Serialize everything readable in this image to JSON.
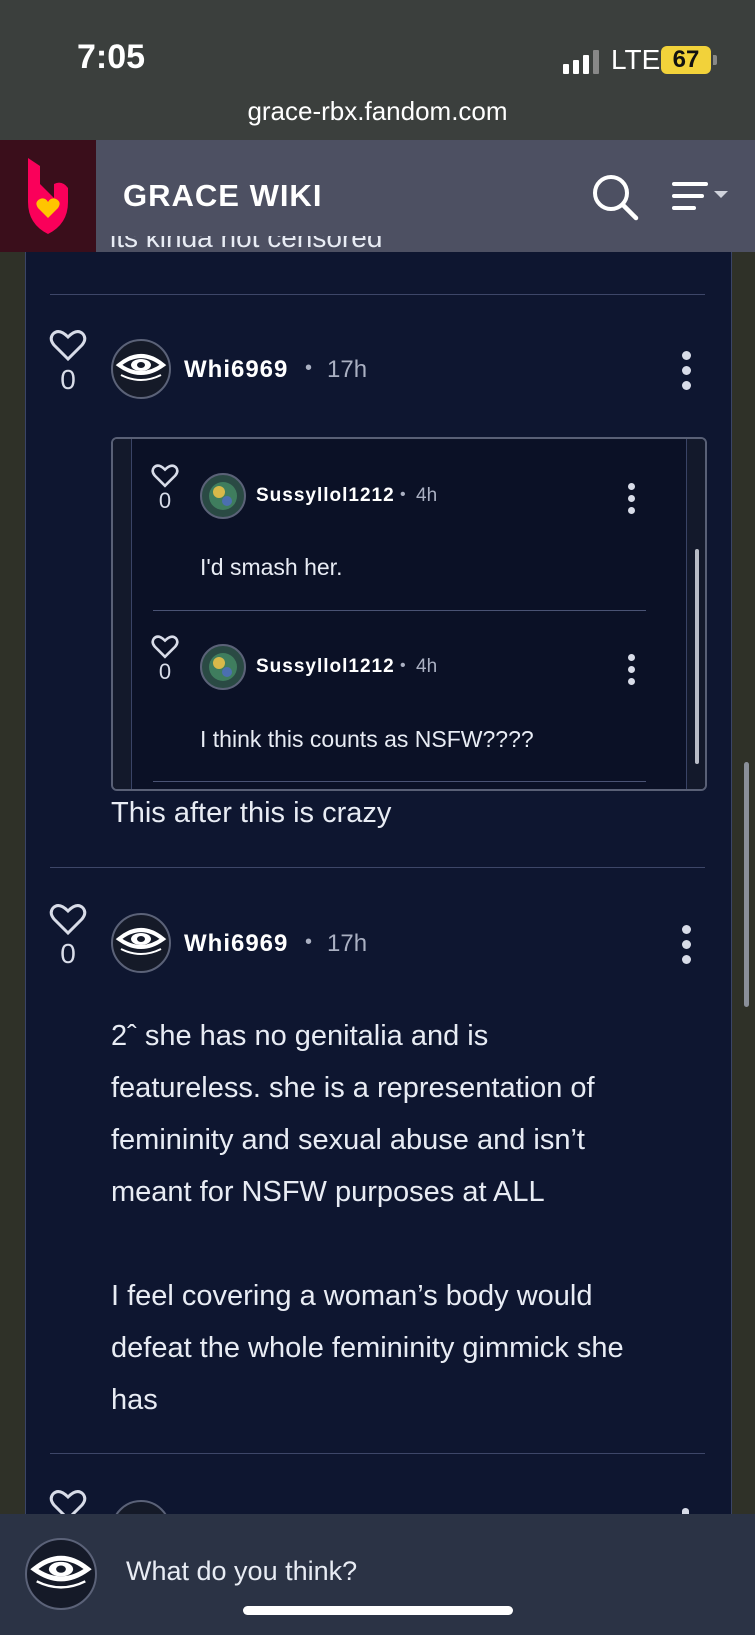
{
  "status_bar": {
    "time": "7:05",
    "network": "LTE",
    "battery": "67"
  },
  "browser": {
    "url": "grace-rbx.fandom.com"
  },
  "header": {
    "site_title": "GRACE WIKI"
  },
  "colors": {
    "brand": "#fa005a",
    "panel_bg": "#0e1630",
    "header_bg": "#4d5062"
  },
  "cut_off_text": "its kinda not censored",
  "comments": [
    {
      "likes": "0",
      "username": "Whi6969",
      "separator": "•",
      "time_ago": "17h",
      "embedded_replies": [
        {
          "likes": "0",
          "username": "Sussyllol1212",
          "separator": "•",
          "time_ago": "4h",
          "text": "I'd smash her."
        },
        {
          "likes": "0",
          "username": "Sussyllol1212",
          "separator": "•",
          "time_ago": "4h",
          "text": "I think this counts as NSFW????"
        }
      ],
      "text": "This after this is crazy"
    },
    {
      "likes": "0",
      "username": "Whi6969",
      "separator": "•",
      "time_ago": "17h",
      "text_lines": [
        "2ˆ she has no genitalia and is",
        "featureless. she is a representation of",
        "femininity and sexual abuse and isn’t",
        "meant for NSFW purposes at ALL",
        "",
        "I feel covering a woman’s body would",
        "defeat the whole femininity gimmick she",
        "has"
      ]
    }
  ],
  "composer": {
    "placeholder": "What do you think?"
  },
  "icons": [
    "fandom-logo-icon",
    "search-icon",
    "menu-icon",
    "heart-icon",
    "kebab-icon",
    "avatar-eye-icon"
  ]
}
